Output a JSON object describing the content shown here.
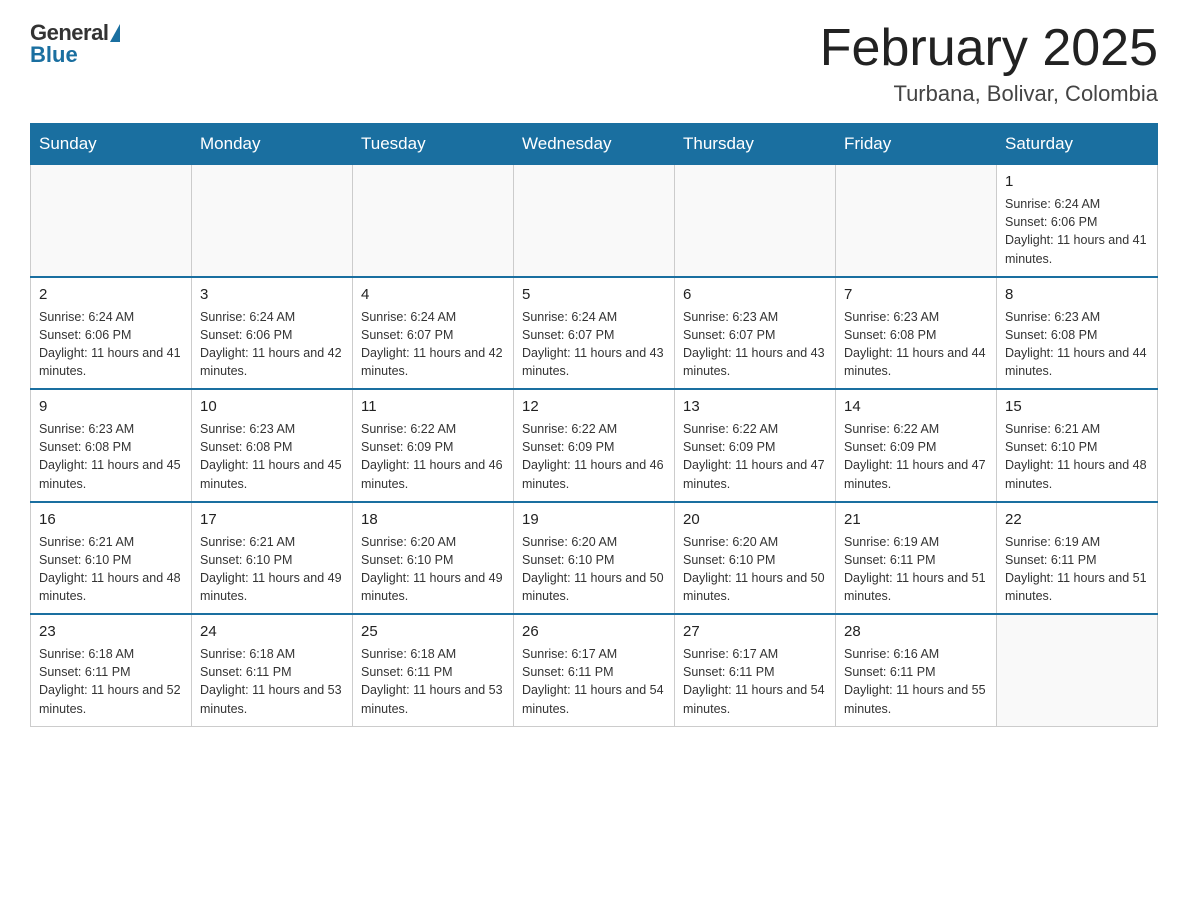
{
  "logo": {
    "general": "General",
    "blue": "Blue"
  },
  "title": {
    "month": "February 2025",
    "location": "Turbana, Bolivar, Colombia"
  },
  "weekdays": [
    "Sunday",
    "Monday",
    "Tuesday",
    "Wednesday",
    "Thursday",
    "Friday",
    "Saturday"
  ],
  "weeks": [
    [
      {
        "day": "",
        "sunrise": "",
        "sunset": "",
        "daylight": ""
      },
      {
        "day": "",
        "sunrise": "",
        "sunset": "",
        "daylight": ""
      },
      {
        "day": "",
        "sunrise": "",
        "sunset": "",
        "daylight": ""
      },
      {
        "day": "",
        "sunrise": "",
        "sunset": "",
        "daylight": ""
      },
      {
        "day": "",
        "sunrise": "",
        "sunset": "",
        "daylight": ""
      },
      {
        "day": "",
        "sunrise": "",
        "sunset": "",
        "daylight": ""
      },
      {
        "day": "1",
        "sunrise": "Sunrise: 6:24 AM",
        "sunset": "Sunset: 6:06 PM",
        "daylight": "Daylight: 11 hours and 41 minutes."
      }
    ],
    [
      {
        "day": "2",
        "sunrise": "Sunrise: 6:24 AM",
        "sunset": "Sunset: 6:06 PM",
        "daylight": "Daylight: 11 hours and 41 minutes."
      },
      {
        "day": "3",
        "sunrise": "Sunrise: 6:24 AM",
        "sunset": "Sunset: 6:06 PM",
        "daylight": "Daylight: 11 hours and 42 minutes."
      },
      {
        "day": "4",
        "sunrise": "Sunrise: 6:24 AM",
        "sunset": "Sunset: 6:07 PM",
        "daylight": "Daylight: 11 hours and 42 minutes."
      },
      {
        "day": "5",
        "sunrise": "Sunrise: 6:24 AM",
        "sunset": "Sunset: 6:07 PM",
        "daylight": "Daylight: 11 hours and 43 minutes."
      },
      {
        "day": "6",
        "sunrise": "Sunrise: 6:23 AM",
        "sunset": "Sunset: 6:07 PM",
        "daylight": "Daylight: 11 hours and 43 minutes."
      },
      {
        "day": "7",
        "sunrise": "Sunrise: 6:23 AM",
        "sunset": "Sunset: 6:08 PM",
        "daylight": "Daylight: 11 hours and 44 minutes."
      },
      {
        "day": "8",
        "sunrise": "Sunrise: 6:23 AM",
        "sunset": "Sunset: 6:08 PM",
        "daylight": "Daylight: 11 hours and 44 minutes."
      }
    ],
    [
      {
        "day": "9",
        "sunrise": "Sunrise: 6:23 AM",
        "sunset": "Sunset: 6:08 PM",
        "daylight": "Daylight: 11 hours and 45 minutes."
      },
      {
        "day": "10",
        "sunrise": "Sunrise: 6:23 AM",
        "sunset": "Sunset: 6:08 PM",
        "daylight": "Daylight: 11 hours and 45 minutes."
      },
      {
        "day": "11",
        "sunrise": "Sunrise: 6:22 AM",
        "sunset": "Sunset: 6:09 PM",
        "daylight": "Daylight: 11 hours and 46 minutes."
      },
      {
        "day": "12",
        "sunrise": "Sunrise: 6:22 AM",
        "sunset": "Sunset: 6:09 PM",
        "daylight": "Daylight: 11 hours and 46 minutes."
      },
      {
        "day": "13",
        "sunrise": "Sunrise: 6:22 AM",
        "sunset": "Sunset: 6:09 PM",
        "daylight": "Daylight: 11 hours and 47 minutes."
      },
      {
        "day": "14",
        "sunrise": "Sunrise: 6:22 AM",
        "sunset": "Sunset: 6:09 PM",
        "daylight": "Daylight: 11 hours and 47 minutes."
      },
      {
        "day": "15",
        "sunrise": "Sunrise: 6:21 AM",
        "sunset": "Sunset: 6:10 PM",
        "daylight": "Daylight: 11 hours and 48 minutes."
      }
    ],
    [
      {
        "day": "16",
        "sunrise": "Sunrise: 6:21 AM",
        "sunset": "Sunset: 6:10 PM",
        "daylight": "Daylight: 11 hours and 48 minutes."
      },
      {
        "day": "17",
        "sunrise": "Sunrise: 6:21 AM",
        "sunset": "Sunset: 6:10 PM",
        "daylight": "Daylight: 11 hours and 49 minutes."
      },
      {
        "day": "18",
        "sunrise": "Sunrise: 6:20 AM",
        "sunset": "Sunset: 6:10 PM",
        "daylight": "Daylight: 11 hours and 49 minutes."
      },
      {
        "day": "19",
        "sunrise": "Sunrise: 6:20 AM",
        "sunset": "Sunset: 6:10 PM",
        "daylight": "Daylight: 11 hours and 50 minutes."
      },
      {
        "day": "20",
        "sunrise": "Sunrise: 6:20 AM",
        "sunset": "Sunset: 6:10 PM",
        "daylight": "Daylight: 11 hours and 50 minutes."
      },
      {
        "day": "21",
        "sunrise": "Sunrise: 6:19 AM",
        "sunset": "Sunset: 6:11 PM",
        "daylight": "Daylight: 11 hours and 51 minutes."
      },
      {
        "day": "22",
        "sunrise": "Sunrise: 6:19 AM",
        "sunset": "Sunset: 6:11 PM",
        "daylight": "Daylight: 11 hours and 51 minutes."
      }
    ],
    [
      {
        "day": "23",
        "sunrise": "Sunrise: 6:18 AM",
        "sunset": "Sunset: 6:11 PM",
        "daylight": "Daylight: 11 hours and 52 minutes."
      },
      {
        "day": "24",
        "sunrise": "Sunrise: 6:18 AM",
        "sunset": "Sunset: 6:11 PM",
        "daylight": "Daylight: 11 hours and 53 minutes."
      },
      {
        "day": "25",
        "sunrise": "Sunrise: 6:18 AM",
        "sunset": "Sunset: 6:11 PM",
        "daylight": "Daylight: 11 hours and 53 minutes."
      },
      {
        "day": "26",
        "sunrise": "Sunrise: 6:17 AM",
        "sunset": "Sunset: 6:11 PM",
        "daylight": "Daylight: 11 hours and 54 minutes."
      },
      {
        "day": "27",
        "sunrise": "Sunrise: 6:17 AM",
        "sunset": "Sunset: 6:11 PM",
        "daylight": "Daylight: 11 hours and 54 minutes."
      },
      {
        "day": "28",
        "sunrise": "Sunrise: 6:16 AM",
        "sunset": "Sunset: 6:11 PM",
        "daylight": "Daylight: 11 hours and 55 minutes."
      },
      {
        "day": "",
        "sunrise": "",
        "sunset": "",
        "daylight": ""
      }
    ]
  ]
}
